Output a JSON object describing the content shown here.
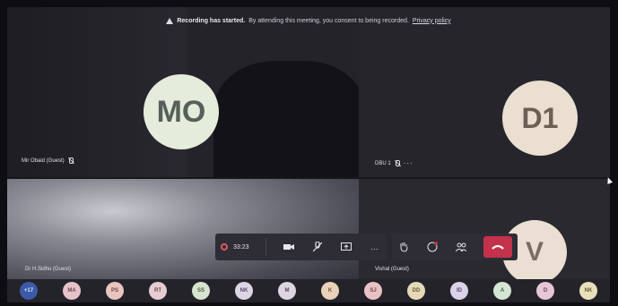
{
  "banner": {
    "title": "Recording has started.",
    "message": "By attending this meeting, you consent to being recorded.",
    "link": "Privacy policy"
  },
  "tiles": {
    "mo": {
      "initials": "MO",
      "name": "Mir Obaid (Guest)"
    },
    "d1": {
      "initials": "D1",
      "name": "DBU 1"
    },
    "hs": {
      "name": "Dr H.Sidhu (Guest)"
    },
    "v": {
      "initials": "V",
      "name": "Vishal (Guest)"
    }
  },
  "toolbar": {
    "timer": "33:23",
    "more": "…"
  },
  "roster": [
    {
      "label": "+17",
      "color": "#3b5aa8",
      "text": "#dfe6ff"
    },
    {
      "label": "MA",
      "color": "#e6c3c9",
      "text": "#6b4a50"
    },
    {
      "label": "PS",
      "color": "#e8c6c0",
      "text": "#6b4a45"
    },
    {
      "label": "RT",
      "color": "#e7cdd1",
      "text": "#6b4d53"
    },
    {
      "label": "SS",
      "color": "#d8e4cf",
      "text": "#4d5c46"
    },
    {
      "label": "NK",
      "color": "#ddd4e6",
      "text": "#54486a"
    },
    {
      "label": "M",
      "color": "#ddd6e2",
      "text": "#56485f"
    },
    {
      "label": "K",
      "color": "#e9d2b8",
      "text": "#6b5440"
    },
    {
      "label": "SJ",
      "color": "#e9c2c6",
      "text": "#6b454a"
    },
    {
      "label": "DD",
      "color": "#e5d9b8",
      "text": "#675a3a"
    },
    {
      "label": "ID",
      "color": "#dad2e6",
      "text": "#54486a"
    },
    {
      "label": "A",
      "color": "#d5e6d4",
      "text": "#47604a"
    },
    {
      "label": "D",
      "color": "#e6c7d6",
      "text": "#6b4659"
    },
    {
      "label": "NK",
      "color": "#e8e0b9",
      "text": "#665b36"
    }
  ]
}
